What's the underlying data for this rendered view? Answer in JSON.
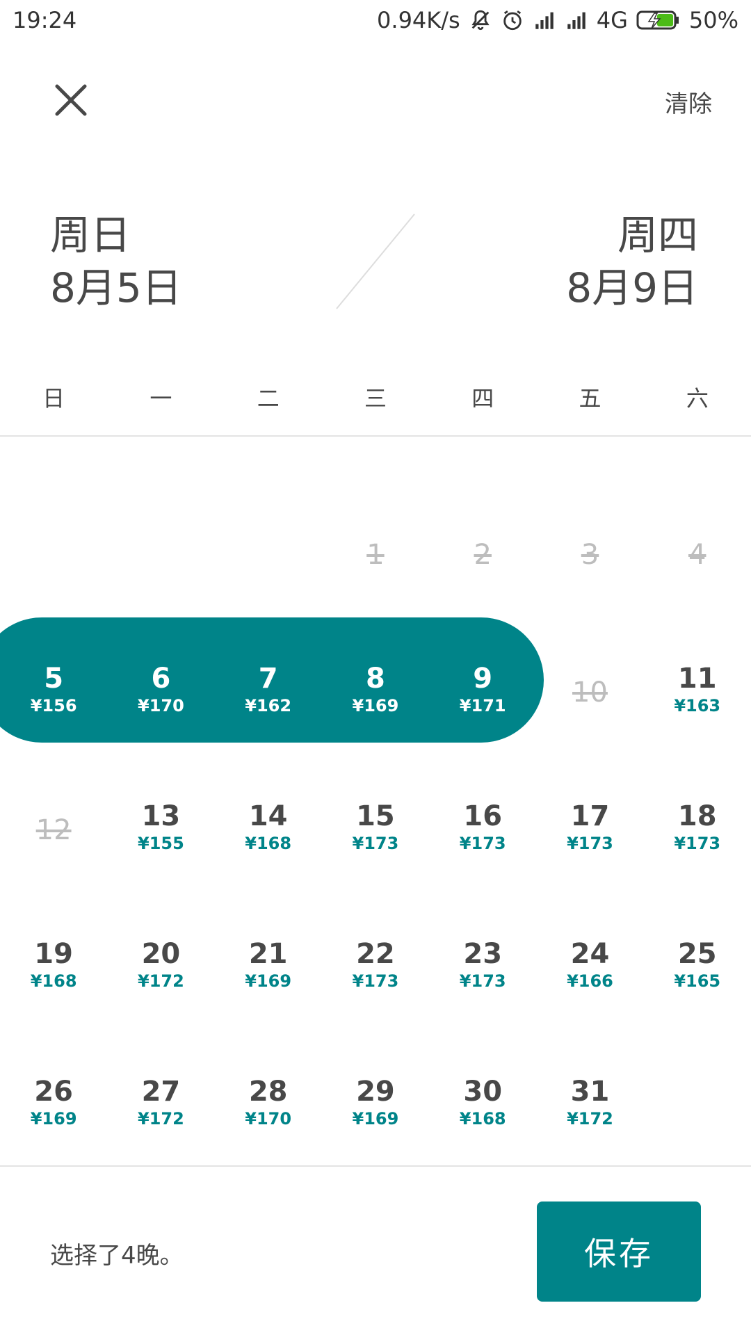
{
  "status_bar": {
    "time": "19:24",
    "speed": "0.94K/s",
    "network": "4G",
    "battery": "50%"
  },
  "header": {
    "close_icon": "close-icon",
    "clear_label": "清除"
  },
  "dates": {
    "start_weekday": "周日",
    "start_date": "8月5日",
    "end_weekday": "周四",
    "end_date": "8月9日"
  },
  "weekdays": [
    "日",
    "一",
    "二",
    "三",
    "四",
    "五",
    "六"
  ],
  "calendar": {
    "accent_color": "#008489",
    "weeks": [
      [
        {
          "day": "",
          "price": "",
          "state": "empty"
        },
        {
          "day": "",
          "price": "",
          "state": "empty"
        },
        {
          "day": "",
          "price": "",
          "state": "empty"
        },
        {
          "day": "1",
          "price": "",
          "state": "disabled"
        },
        {
          "day": "2",
          "price": "",
          "state": "disabled"
        },
        {
          "day": "3",
          "price": "",
          "state": "disabled"
        },
        {
          "day": "4",
          "price": "",
          "state": "disabled"
        }
      ],
      [
        {
          "day": "5",
          "price": "¥156",
          "state": "selected"
        },
        {
          "day": "6",
          "price": "¥170",
          "state": "selected"
        },
        {
          "day": "7",
          "price": "¥162",
          "state": "selected"
        },
        {
          "day": "8",
          "price": "¥169",
          "state": "selected"
        },
        {
          "day": "9",
          "price": "¥171",
          "state": "selected"
        },
        {
          "day": "10",
          "price": "",
          "state": "disabled"
        },
        {
          "day": "11",
          "price": "¥163",
          "state": "available"
        }
      ],
      [
        {
          "day": "12",
          "price": "",
          "state": "disabled"
        },
        {
          "day": "13",
          "price": "¥155",
          "state": "available"
        },
        {
          "day": "14",
          "price": "¥168",
          "state": "available"
        },
        {
          "day": "15",
          "price": "¥173",
          "state": "available"
        },
        {
          "day": "16",
          "price": "¥173",
          "state": "available"
        },
        {
          "day": "17",
          "price": "¥173",
          "state": "available"
        },
        {
          "day": "18",
          "price": "¥173",
          "state": "available"
        }
      ],
      [
        {
          "day": "19",
          "price": "¥168",
          "state": "available"
        },
        {
          "day": "20",
          "price": "¥172",
          "state": "available"
        },
        {
          "day": "21",
          "price": "¥169",
          "state": "available"
        },
        {
          "day": "22",
          "price": "¥173",
          "state": "available"
        },
        {
          "day": "23",
          "price": "¥173",
          "state": "available"
        },
        {
          "day": "24",
          "price": "¥166",
          "state": "available"
        },
        {
          "day": "25",
          "price": "¥165",
          "state": "available"
        }
      ],
      [
        {
          "day": "26",
          "price": "¥169",
          "state": "available"
        },
        {
          "day": "27",
          "price": "¥172",
          "state": "available"
        },
        {
          "day": "28",
          "price": "¥170",
          "state": "available"
        },
        {
          "day": "29",
          "price": "¥169",
          "state": "available"
        },
        {
          "day": "30",
          "price": "¥168",
          "state": "available"
        },
        {
          "day": "31",
          "price": "¥172",
          "state": "available"
        },
        {
          "day": "",
          "price": "",
          "state": "empty"
        }
      ]
    ]
  },
  "footer": {
    "nights_text": "选择了4晚。",
    "save_label": "保存"
  }
}
